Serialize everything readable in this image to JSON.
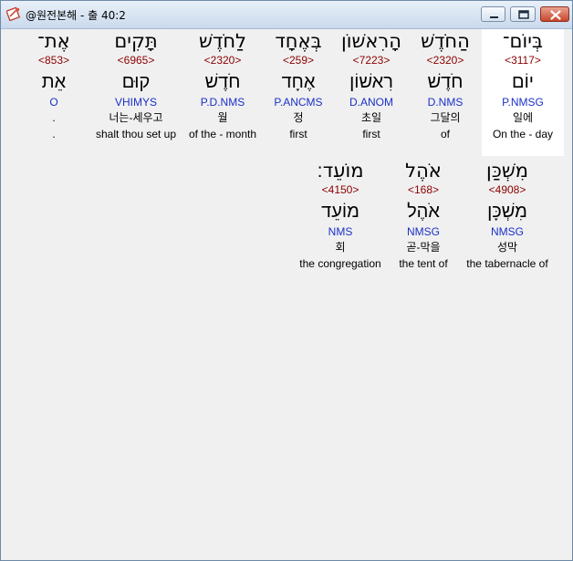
{
  "window": {
    "title": "@원전본해 - 출 40:2"
  },
  "verse": {
    "row1": [
      {
        "hebrew": "בְּיוֹם־",
        "strongs": "<3117>",
        "lemma": "יוֹם",
        "morph": "P.NMSG",
        "korean": "일에",
        "english": "On the - day",
        "highlighted": true
      },
      {
        "hebrew": "הַחֹדֶשׁ",
        "strongs": "<2320>",
        "lemma": "חֹדֶשׁ",
        "morph": "D.NMS",
        "korean": "그달의",
        "english": "of"
      },
      {
        "hebrew": "הָרִאשׁוֹן",
        "strongs": "<7223>",
        "lemma": "רִאשׁוֹן",
        "morph": "D.ANOM",
        "korean": "초일",
        "english": "first"
      },
      {
        "hebrew": "בְּאֶחָד",
        "strongs": "<259>",
        "lemma": "אֶחָד",
        "morph": "P.ANCMS",
        "korean": "정",
        "english": "first"
      },
      {
        "hebrew": "לַחֹדֶשׁ",
        "strongs": "<2320>",
        "lemma": "חֹדֶשׁ",
        "morph": "P.D.NMS",
        "korean": "월",
        "english": "of the - month"
      },
      {
        "hebrew": "תָּקִים",
        "strongs": "<6965>",
        "lemma": "קוּם",
        "morph": "VHIMYS",
        "korean": "너는-세우고",
        "english": "shalt thou set up"
      },
      {
        "hebrew": "אֶת־",
        "strongs": "<853>",
        "lemma": "אֵת",
        "morph": "O",
        "korean": ".",
        "english": "."
      }
    ],
    "row2": [
      {
        "hebrew": "מִשְׁכַּן",
        "strongs": "<4908>",
        "lemma": "מִשְׁכָּן",
        "morph": "NMSG",
        "korean": "성막",
        "english": "the tabernacle of"
      },
      {
        "hebrew": "אֹהֶל",
        "strongs": "<168>",
        "lemma": "אֹהֶל",
        "morph": "NMSG",
        "korean": "곧-막을",
        "english": "the tent of"
      },
      {
        "hebrew": "מוֹעֵד׃",
        "strongs": "<4150>",
        "lemma": "מוֹעֵד",
        "morph": "NMS",
        "korean": "회",
        "english": "the congregation"
      }
    ]
  }
}
